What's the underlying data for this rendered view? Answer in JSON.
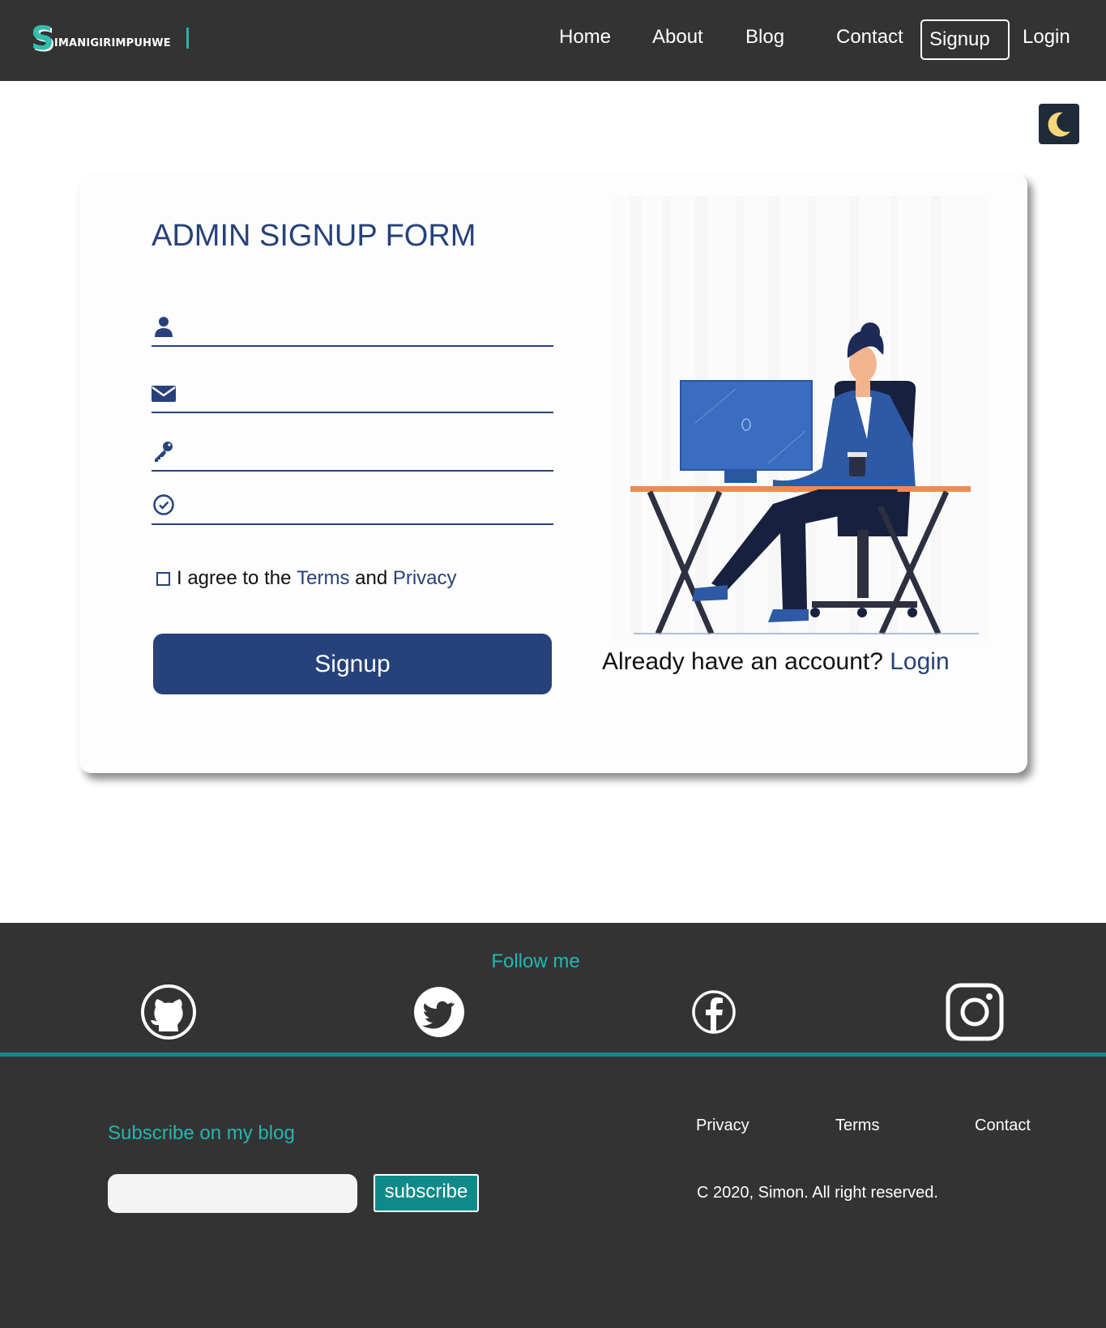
{
  "header": {
    "logo_initial": "S",
    "logo_text": "IMANIGIRIMPUHWE",
    "nav": {
      "home": "Home",
      "about": "About",
      "blog": "Blog",
      "contact": "Contact",
      "signup": "Signup",
      "login": "Login"
    }
  },
  "theme_toggle": {
    "icon": "moon-icon"
  },
  "form": {
    "title": "ADMIN SIGNUP FORM",
    "fields": [
      {
        "icon": "user-icon",
        "value": "",
        "placeholder": ""
      },
      {
        "icon": "envelope-icon",
        "value": "",
        "placeholder": ""
      },
      {
        "icon": "key-icon",
        "value": "",
        "placeholder": ""
      },
      {
        "icon": "check-circle-icon",
        "value": "",
        "placeholder": ""
      }
    ],
    "agree_prefix": "I agree to the",
    "terms_label": "Terms",
    "and_text": "and",
    "privacy_label": "Privacy",
    "submit_label": "Signup",
    "already_text": "Already have an account?",
    "login_link": "Login"
  },
  "footer": {
    "follow_title": "Follow me",
    "social_icons": [
      "github-icon",
      "twitter-icon",
      "facebook-icon",
      "instagram-icon"
    ],
    "subscribe_title": "Subscribe on my blog",
    "subscribe_input": {
      "value": "",
      "placeholder": ""
    },
    "subscribe_button": "subscribe",
    "links": {
      "privacy": "Privacy",
      "terms": "Terms",
      "contact": "Contact"
    },
    "copyright": "C 2020, Simon. All right reserved."
  },
  "colors": {
    "header_bg": "#333333",
    "primary": "#27427a",
    "accent": "#21b8b0",
    "footer_teal": "#0f8a88"
  }
}
